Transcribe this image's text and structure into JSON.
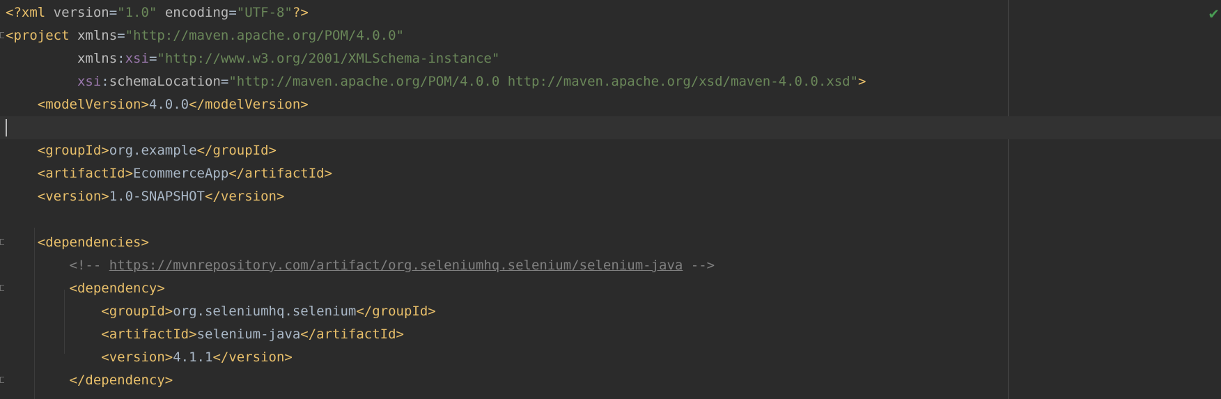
{
  "editor": {
    "language": "XML",
    "status_icon": "check-icon",
    "status_color": "#499c54",
    "colors": {
      "background": "#2b2b2b",
      "tag": "#e8bf6a",
      "string": "#6a8759",
      "namespace": "#9876aa",
      "text": "#a9b7c6",
      "comment": "#808080"
    },
    "lines": [
      {
        "xml_open": "<?xml ",
        "attr_version": "version",
        "eq1": "=",
        "val_version": "\"1.0\"",
        "sp1": " ",
        "attr_encoding": "encoding",
        "eq2": "=",
        "val_encoding": "\"UTF-8\"",
        "xml_close": "?>"
      },
      {
        "tag_open": "<project ",
        "attr_xmlns": "xmlns",
        "eq": "=",
        "val": "\"http://maven.apache.org/POM/4.0.0\""
      },
      {
        "indent": "         ",
        "attr_xmlns": "xmlns",
        "colon": ":",
        "ns_xsi": "xsi",
        "eq": "=",
        "val": "\"http://www.w3.org/2001/XMLSchema-instance\""
      },
      {
        "indent": "         ",
        "ns_xsi": "xsi",
        "colon": ":",
        "attr_schema": "schemaLocation",
        "eq": "=",
        "val": "\"http://maven.apache.org/POM/4.0.0 http://maven.apache.org/xsd/maven-4.0.0.xsd\"",
        "tag_close": ">"
      },
      {
        "indent": "    ",
        "open": "<modelVersion>",
        "text": "4.0.0",
        "close": "</modelVersion>"
      },
      {
        "text": ""
      },
      {
        "indent": "    ",
        "open": "<groupId>",
        "text": "org.example",
        "close": "</groupId>"
      },
      {
        "indent": "    ",
        "open": "<artifactId>",
        "text": "EcommerceApp",
        "close": "</artifactId>"
      },
      {
        "indent": "    ",
        "open": "<version>",
        "text": "1.0-SNAPSHOT",
        "close": "</version>"
      },
      {
        "text": ""
      },
      {
        "indent": "    ",
        "open": "<dependencies>"
      },
      {
        "indent": "        ",
        "comment_open": "<!-- ",
        "link": "https://mvnrepository.com/artifact/org.seleniumhq.selenium/selenium-java",
        "comment_close": " -->"
      },
      {
        "indent": "        ",
        "open": "<dependency>"
      },
      {
        "indent": "            ",
        "open": "<groupId>",
        "text": "org.seleniumhq.selenium",
        "close": "</groupId>"
      },
      {
        "indent": "            ",
        "open": "<artifactId>",
        "text": "selenium-java",
        "close": "</artifactId>"
      },
      {
        "indent": "            ",
        "open": "<version>",
        "text": "4.1.1",
        "close": "</version>"
      },
      {
        "indent": "        ",
        "close": "</dependency>"
      }
    ]
  }
}
